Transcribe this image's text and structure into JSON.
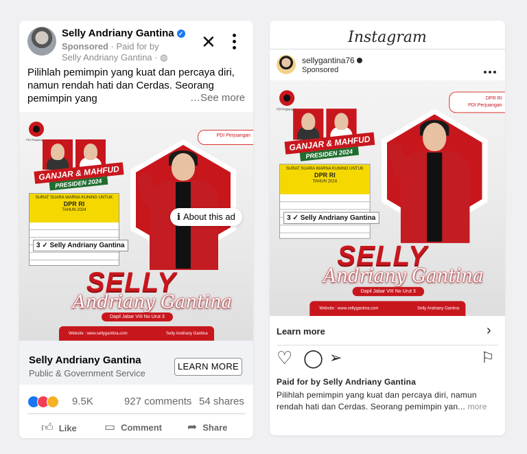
{
  "colors": {
    "brand_red": "#c8161d",
    "fb_blue": "#1877f2",
    "ballot_yellow": "#f5d800"
  },
  "facebook": {
    "page_name": "Selly Andriany Gantina",
    "meta": "Sponsored · Paid for by Selly Andriany Gantina ·",
    "meta_bold": "Sponsored",
    "meta_rest": " · Paid for by Selly Andriany Gantina · ",
    "post_text": "Pilihlah pemimpin yang kuat dan percaya diri, namun rendah hati dan Cerdas. Seorang pemimpin yang",
    "see_more": "…See more",
    "about_ad": "About this ad",
    "cta_name": "Selly Andriany Gantina",
    "cta_category": "Public & Government Service",
    "cta_button": "LEARN MORE",
    "reactions_count": "9.5K",
    "comments": "927 comments",
    "shares": "54 shares",
    "actions": {
      "like": "Like",
      "comment": "Comment",
      "share": "Share"
    },
    "icons": [
      "close-icon",
      "more-vertical-icon",
      "like-icon",
      "comment-icon",
      "share-icon",
      "globe-icon",
      "verified-icon"
    ]
  },
  "creative": {
    "pdi_label": "PDI Perjuangan",
    "dpr_label": "DPR RI",
    "ganjar_mahfud": "GANJAR & MAHFUD",
    "presiden": "PRESIDEN 2024",
    "ballot_title": "SURAT SUARA WARNA KUNING UNTUK",
    "ballot_dpr": "DPR RI",
    "ballot_year": "TAHUN 2024",
    "ballot_label": "3 ✓ Selly Andriany Gantina",
    "selly": "SELLY",
    "fullname": "Andriany Gantina",
    "dapil": "Dapil Jabar VIII No Urut 3",
    "website": "Website : www.sellygantina.com",
    "social": "Selly Andriany Gantina"
  },
  "instagram": {
    "logo": "Instagram",
    "username": "sellygantina76",
    "sponsored": "Sponsored",
    "learn_more": "Learn more",
    "paid_for": "Paid for by Selly Andriany Gantina",
    "caption": "Pilihlah pemimpin yang kuat dan percaya diri, namun rendah hati dan Cerdas. Seorang pemimpin yan...",
    "more": "more",
    "icons": [
      "heart-icon",
      "comment-icon",
      "send-icon",
      "bookmark-icon",
      "chevron-right-icon",
      "more-horizontal-icon"
    ]
  }
}
